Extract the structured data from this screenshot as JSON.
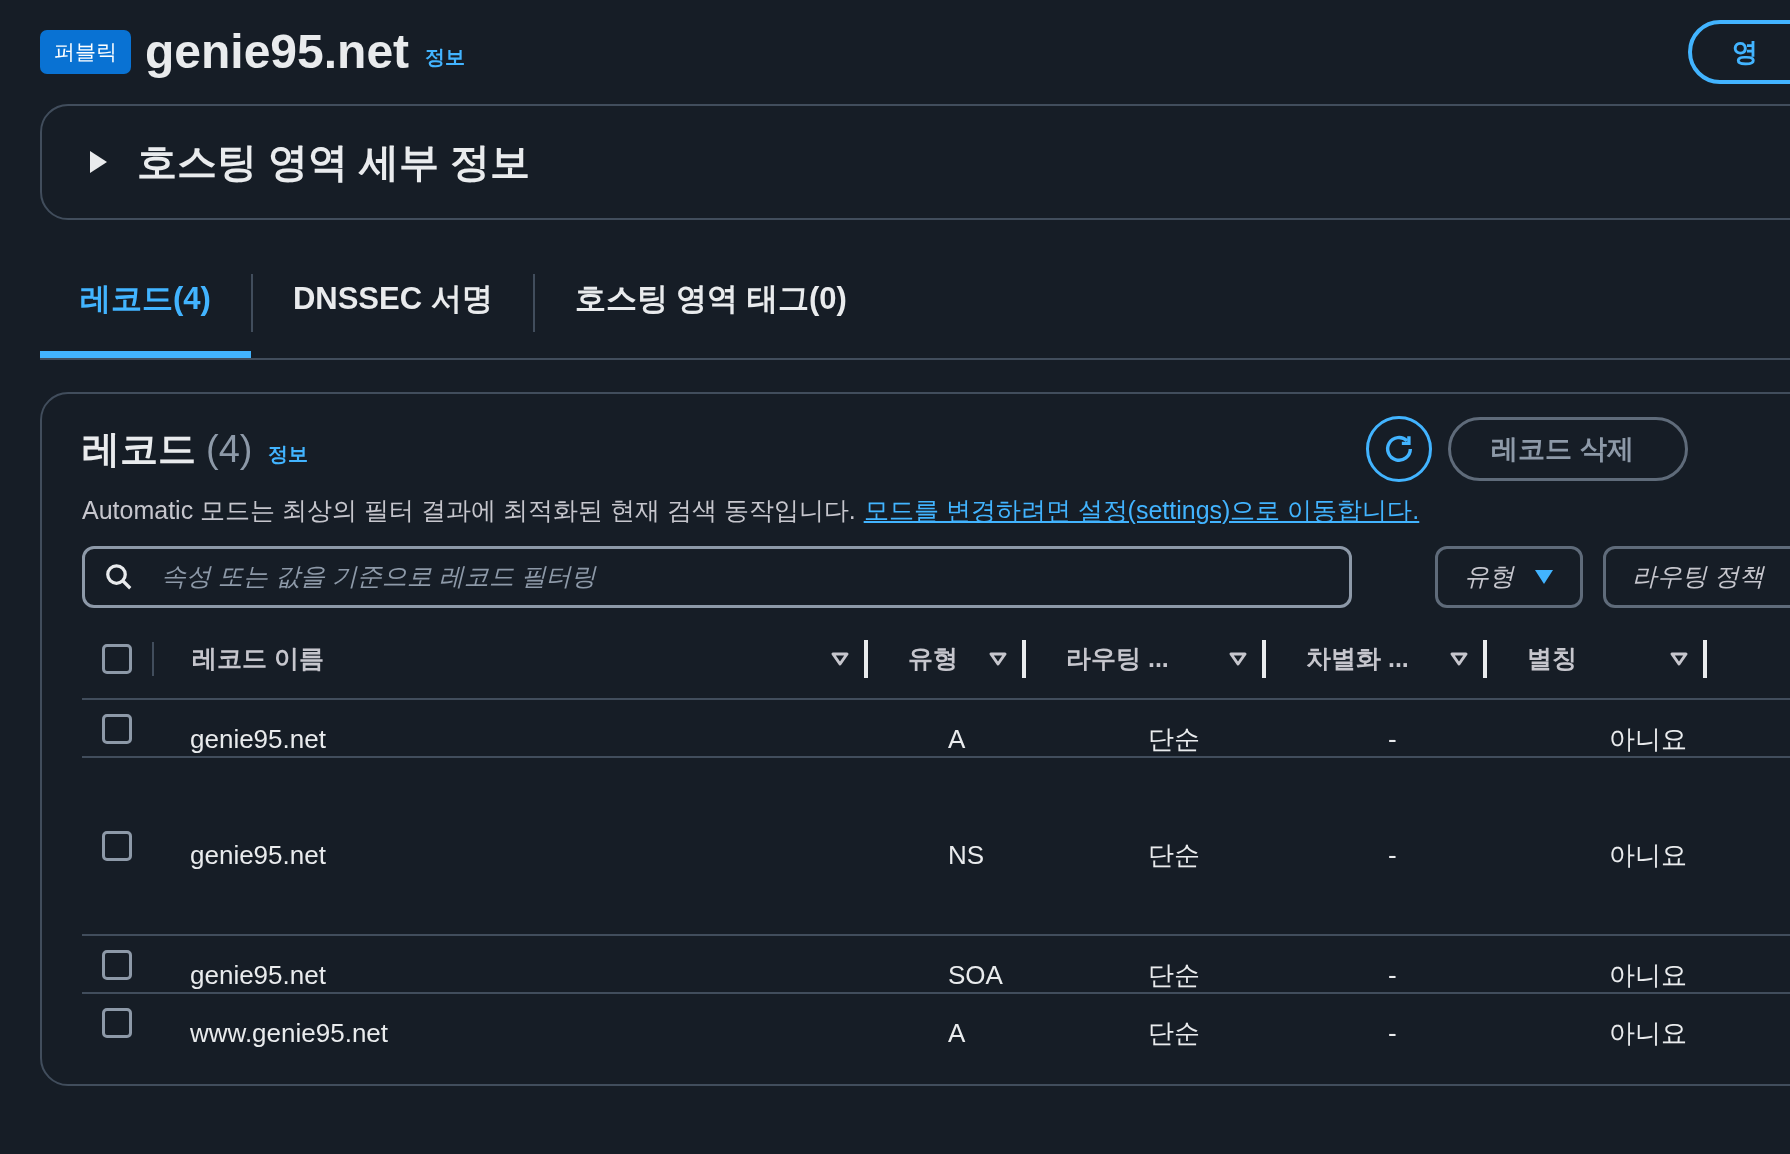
{
  "header": {
    "badge": "퍼블릭",
    "title": "genie95.net",
    "info_link": "정보",
    "action_button": "영"
  },
  "details": {
    "title": "호스팅 영역 세부 정보",
    "expanded": false
  },
  "tabs": [
    {
      "label": "레코드(4)",
      "selected": true
    },
    {
      "label": "DNSSEC 서명",
      "selected": false
    },
    {
      "label": "호스팅 영역 태그(0)",
      "selected": false
    }
  ],
  "records": {
    "title": "레코드",
    "count": "(4)",
    "info_link": "정보",
    "description": "Automatic 모드는 최상의 필터 결과에 최적화된 현재 검색 동작입니다.",
    "settings_link": "모드를 변경하려면 설정(settings)으로 이동합니다.",
    "delete_button": "레코드 삭제",
    "search": {
      "placeholder": "속성 또는 값을 기준으로 레코드 필터링"
    },
    "filters": [
      {
        "label": "유형",
        "active": true
      },
      {
        "label": "라우팅 정책",
        "active": false
      }
    ],
    "select_all": {
      "checked": false
    },
    "columns": [
      "레코드 이름",
      "유형",
      "라우팅 ...",
      "차별화 ...",
      "별칭"
    ],
    "rows": [
      {
        "checked": false,
        "kind": "single",
        "cells": [
          "genie95.net",
          "A",
          "단순",
          "-",
          "아니요"
        ]
      },
      {
        "checked": false,
        "kind": "multi",
        "cells": [
          "genie95.net",
          "NS",
          "단순",
          "-",
          "아니요"
        ]
      },
      {
        "checked": false,
        "kind": "single",
        "cells": [
          "genie95.net",
          "SOA",
          "단순",
          "-",
          "아니요"
        ]
      },
      {
        "checked": false,
        "kind": "single",
        "cells": [
          "www.genie95.net",
          "A",
          "단순",
          "-",
          "아니요"
        ]
      }
    ]
  }
}
